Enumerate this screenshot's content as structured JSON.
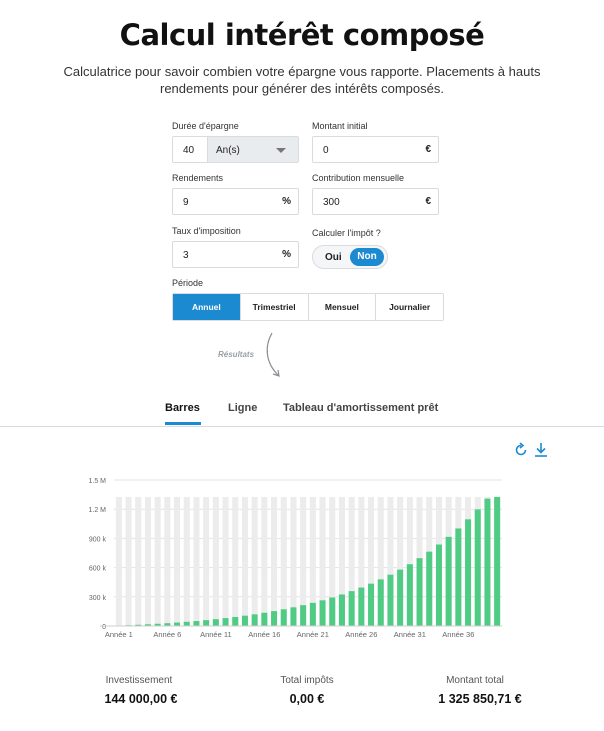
{
  "header": {
    "title": "Calcul intérêt composé",
    "subtitle": "Calculatrice pour savoir combien votre épargne vous rapporte. Placements à hauts rendements pour générer des intérêts composés."
  },
  "form": {
    "duree": {
      "label": "Durée d'épargne",
      "value": "40",
      "unit_select": "An(s)"
    },
    "montant": {
      "label": "Montant initial",
      "value": "0",
      "unit": "€"
    },
    "rendements": {
      "label": "Rendements",
      "value": "9",
      "unit": "%"
    },
    "contribution": {
      "label": "Contribution mensuelle",
      "value": "300",
      "unit": "€"
    },
    "taux": {
      "label": "Taux d'imposition",
      "value": "3",
      "unit": "%"
    },
    "impot": {
      "label": "Calculer l'impôt ?",
      "oui": "Oui",
      "non": "Non",
      "selected": "Non"
    },
    "periode": {
      "label": "Période",
      "options": [
        "Annuel",
        "Trimestriel",
        "Mensuel",
        "Journalier"
      ],
      "selected": "Annuel"
    }
  },
  "results_label": "Résultats",
  "tabs": {
    "items": [
      "Barres",
      "Ligne",
      "Tableau d'amortissement prêt"
    ],
    "active": "Barres"
  },
  "toolbar": {
    "reset_icon": "refresh-icon",
    "download_icon": "download-icon"
  },
  "colors": {
    "accent": "#1c8ad1",
    "bar": "#4fcb83",
    "bar_bg": "#ececec"
  },
  "chart_data": {
    "type": "bar",
    "x_ticks": [
      "Année 1",
      "Année 6",
      "Année 11",
      "Année 16",
      "Année 21",
      "Année 26",
      "Année 31",
      "Année 36"
    ],
    "y_ticks": [
      "0",
      "300 k",
      "600 k",
      "900 k",
      "1.2 M",
      "1.5 M"
    ],
    "ylim": [
      0,
      1500000
    ],
    "grid": true,
    "values": [
      3600,
      8000,
      12500,
      17500,
      23000,
      29000,
      35500,
      43000,
      51000,
      60000,
      70000,
      81000,
      93000,
      106000,
      120000,
      136000,
      153000,
      172000,
      192000,
      214000,
      238000,
      264000,
      293000,
      324000,
      358000,
      395000,
      435000,
      479000,
      527000,
      579000,
      635000,
      697000,
      764000,
      837000,
      916000,
      1002000,
      1096000,
      1198000,
      1308000,
      1325850
    ]
  },
  "summary": {
    "investissement": {
      "label": "Investissement",
      "value": "144 000,00 €"
    },
    "impots": {
      "label": "Total impôts",
      "value": "0,00 €"
    },
    "total": {
      "label": "Montant total",
      "value": "1 325 850,71 €"
    }
  }
}
